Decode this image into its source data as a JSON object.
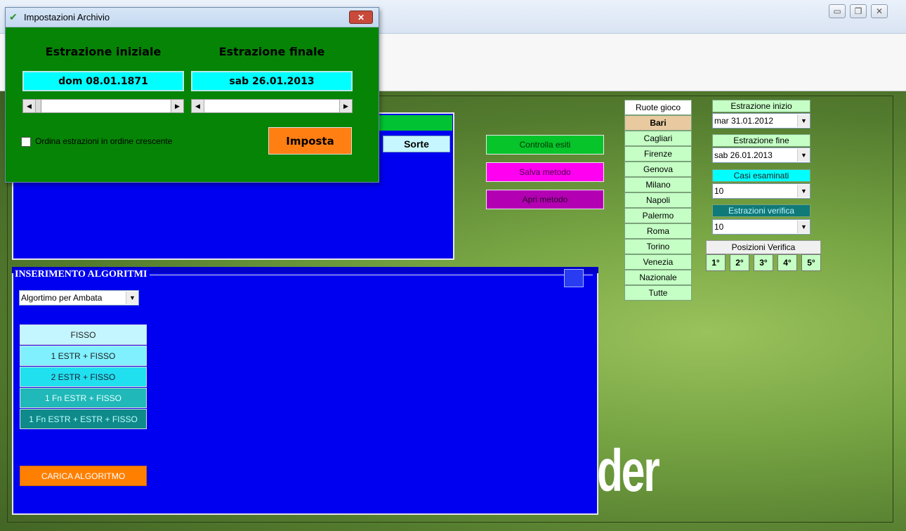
{
  "dialog": {
    "title": "Impostazioni Archivio",
    "close_glyph": "✕",
    "start_label": "Estrazione iniziale",
    "end_label": "Estrazione finale",
    "start_value": "dom 08.01.1871",
    "end_value": "sab 26.01.2013",
    "sort_checkbox_label": "Ordina estrazioni in ordine crescente",
    "sort_checked": false,
    "imposta_label": "Imposta"
  },
  "window_controls": {
    "minimize": "▭",
    "restore": "❐",
    "close": "✕"
  },
  "results_table": {
    "sorte_header": "Sorte"
  },
  "actions": {
    "controlla": "Controlla esiti",
    "salva": "Salva metodo",
    "apri": "Apri metodo"
  },
  "ruote": {
    "header": "Ruote gioco",
    "items": [
      "Bari",
      "Cagliari",
      "Firenze",
      "Genova",
      "Milano",
      "Napoli",
      "Palermo",
      "Roma",
      "Torino",
      "Venezia",
      "Nazionale",
      "Tutte"
    ],
    "selected": "Bari"
  },
  "settings": {
    "estrazione_inizio_label": "Estrazione inizio",
    "estrazione_inizio_value": "mar 31.01.2012",
    "estrazione_fine_label": "Estrazione fine",
    "estrazione_fine_value": "sab 26.01.2013",
    "casi_label": "Casi esaminati",
    "casi_value": "10",
    "verifica_label": "Estrazioni verifica",
    "verifica_value": "10",
    "posizioni_label": "Posizioni Verifica",
    "posizioni": [
      "1°",
      "2°",
      "3°",
      "4°",
      "5°"
    ]
  },
  "algoritmi": {
    "legend": "INSERIMENTO ALGORITMI",
    "select_value": "Algortimo per Ambata",
    "buttons": [
      "FISSO",
      "1 ESTR + FISSO",
      "2 ESTR + FISSO",
      "1 Fn ESTR + FISSO",
      "1 Fn ESTR + ESTR + FISSO"
    ],
    "button_colors": [
      "#c4f6ff",
      "#80f0ff",
      "#20e0f0",
      "#20b8b8",
      "#0f8a8a"
    ],
    "carica": "CARICA ALGORITMO"
  },
  "watermark": "der",
  "colors": {
    "panel_blue": "#0000f0",
    "dialog_green": "#068406",
    "accent_orange": "#ff7f12"
  }
}
